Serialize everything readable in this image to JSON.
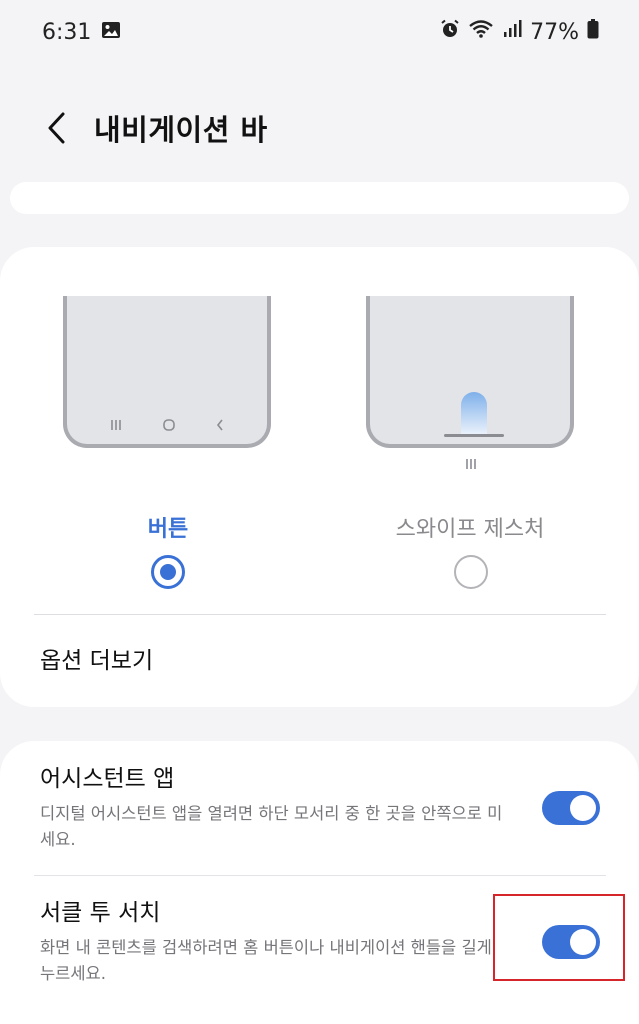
{
  "status_bar": {
    "time": "6:31",
    "battery_percent": "77%",
    "icons": [
      "gallery-icon",
      "alarm-icon",
      "wifi-icon",
      "signal-icon",
      "battery-icon"
    ]
  },
  "header": {
    "title": "내비게이션 바"
  },
  "navigation_type": {
    "options": [
      {
        "label": "버튼",
        "selected": true
      },
      {
        "label": "스와이프 제스처",
        "selected": false
      }
    ],
    "more_options_label": "옵션 더보기"
  },
  "settings": {
    "assistant_app": {
      "title": "어시스턴트 앱",
      "description": "디지털 어시스턴트 앱을 열려면 하단 모서리 중 한 곳을 안쪽으로 미세요.",
      "enabled": true
    },
    "circle_to_search": {
      "title": "서클 투 서치",
      "description": "화면 내 콘텐츠를 검색하려면 홈 버튼이나 내비게이션 핸들을 길게 누르세요.",
      "enabled": true
    }
  },
  "colors": {
    "accent": "#3a71d6",
    "highlight": "#d6262c",
    "background": "#f4f4f6"
  }
}
